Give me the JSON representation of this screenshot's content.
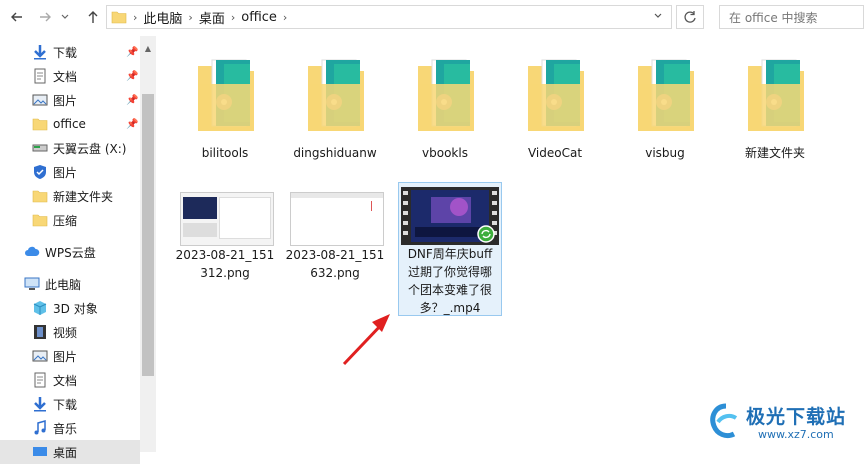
{
  "nav": {
    "back_icon": "arrow-left-icon",
    "forward_icon": "arrow-right-icon",
    "recent_icon": "chevron-down-icon",
    "up_icon": "arrow-up-icon"
  },
  "address": {
    "crumbs": [
      "此电脑",
      "桌面",
      "office"
    ],
    "dropdown_icon": "chevron-down-icon",
    "refresh_icon": "refresh-icon"
  },
  "search": {
    "placeholder": "在 office 中搜索"
  },
  "sidebar": {
    "quick_access": [
      {
        "label": "下载",
        "pinned": true
      },
      {
        "label": "文档",
        "pinned": true
      },
      {
        "label": "图片",
        "pinned": true
      },
      {
        "label": "office",
        "pinned": true
      },
      {
        "label": "天翼云盘 (X:)"
      },
      {
        "label": "图片"
      },
      {
        "label": "新建文件夹"
      },
      {
        "label": "压缩"
      }
    ],
    "wps": "WPS云盘",
    "this_pc": "此电脑",
    "pc_items": [
      "3D 对象",
      "视频",
      "图片",
      "文档",
      "下载",
      "音乐",
      "桌面"
    ]
  },
  "folders": [
    "bilitools",
    "dingshiduanw",
    "vbookls",
    "VideoCat",
    "visbug",
    "新建文件夹"
  ],
  "files": [
    {
      "name_line1": "2023-08-21_151",
      "name_line2": "312.png"
    },
    {
      "name_line1": "2023-08-21_151",
      "name_line2": "632.png"
    },
    {
      "name_line1": "DNF周年庆buff",
      "name_line2": "过期了你觉得哪",
      "name_line3": "个团本变难了很",
      "name_line4": "多？_.mp4"
    }
  ],
  "colors": {
    "folder": "#f8d776",
    "selection": "#e5f1fb",
    "selection_border": "#99c9ef",
    "arrow": "#e02020"
  },
  "watermark": {
    "text": "极光下载站",
    "url": "www.xz7.com"
  }
}
